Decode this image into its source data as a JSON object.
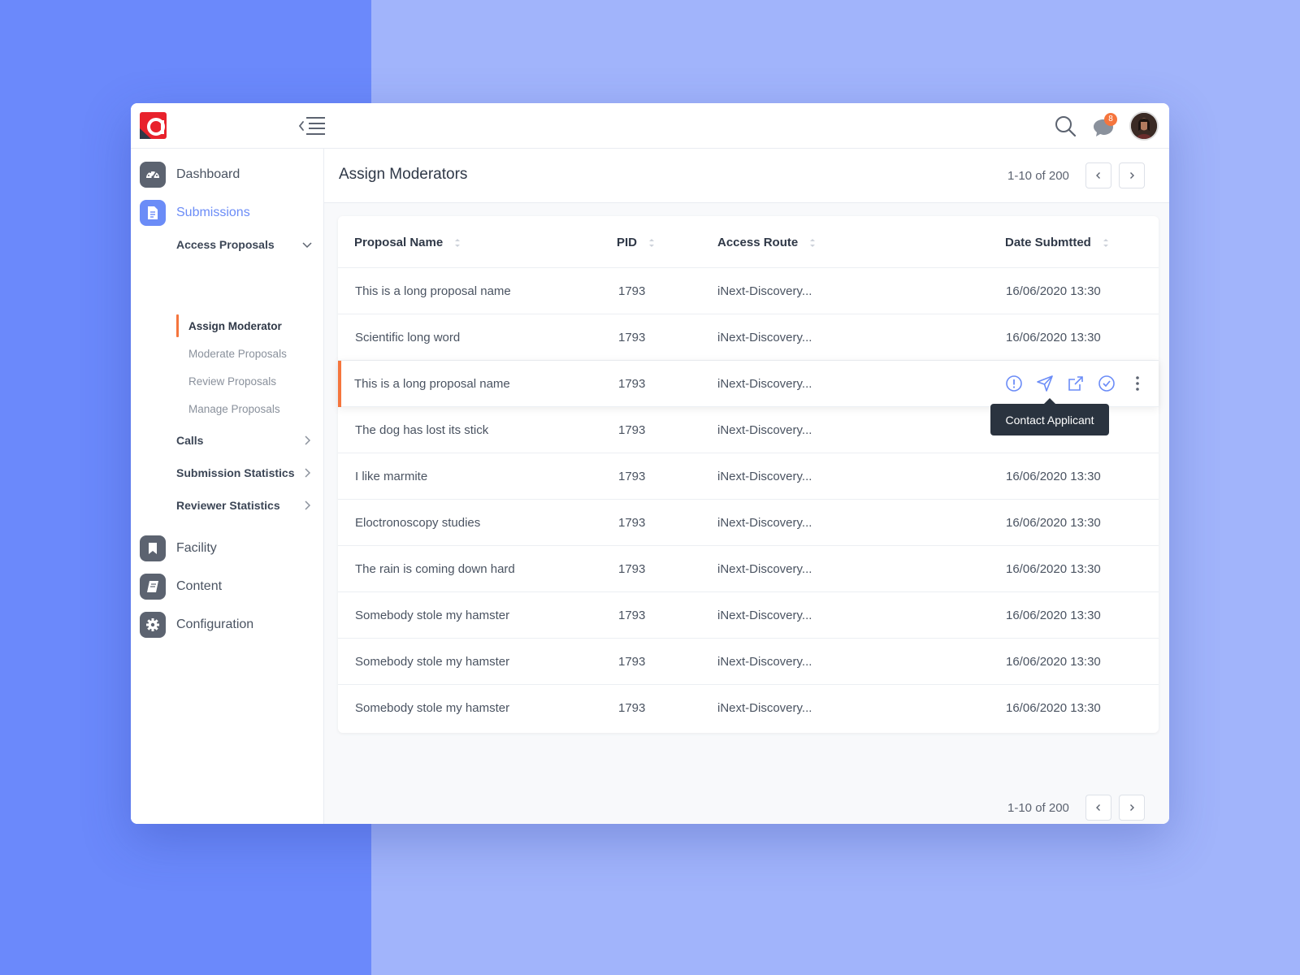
{
  "colors": {
    "accent": "#6b8cf7",
    "highlight": "#f5753d",
    "dark": "#2a333f"
  },
  "header": {
    "notification_count": "8"
  },
  "sidebar": {
    "dashboard": "Dashboard",
    "submissions": "Submissions",
    "access_proposals": "Access Proposals",
    "sub_items": [
      "Assign Moderator",
      "Moderate Proposals",
      "Review Proposals",
      "Manage Proposals"
    ],
    "calls": "Calls",
    "submission_statistics": "Submission Statistics",
    "reviewer_statistics": "Reviewer Statistics",
    "facility": "Facility",
    "content": "Content",
    "configuration": "Configuration"
  },
  "main": {
    "title": "Assign Moderators",
    "pagination": "1-10 of 200",
    "columns": [
      "Proposal Name",
      "PID",
      "Access Route",
      "Date Submtted"
    ],
    "tooltip": "Contact Applicant",
    "rows": [
      {
        "name": "This is a long proposal name",
        "pid": "1793",
        "route": "iNext-Discovery...",
        "date": "16/06/2020 13:30"
      },
      {
        "name": "Scientific long word",
        "pid": "1793",
        "route": "iNext-Discovery...",
        "date": "16/06/2020 13:30"
      },
      {
        "name": "This is a long proposal name",
        "pid": "1793",
        "route": "iNext-Discovery...",
        "date": ""
      },
      {
        "name": "The dog has lost its stick",
        "pid": "1793",
        "route": "iNext-Discovery...",
        "date": ""
      },
      {
        "name": "I like marmite",
        "pid": "1793",
        "route": "iNext-Discovery...",
        "date": "16/06/2020 13:30"
      },
      {
        "name": "Eloctronoscopy studies",
        "pid": "1793",
        "route": "iNext-Discovery...",
        "date": "16/06/2020 13:30"
      },
      {
        "name": "The rain is coming down hard",
        "pid": "1793",
        "route": "iNext-Discovery...",
        "date": "16/06/2020 13:30"
      },
      {
        "name": "Somebody stole my hamster",
        "pid": "1793",
        "route": "iNext-Discovery...",
        "date": "16/06/2020 13:30"
      },
      {
        "name": "Somebody stole my hamster",
        "pid": "1793",
        "route": "iNext-Discovery...",
        "date": "16/06/2020 13:30"
      },
      {
        "name": "Somebody stole my hamster",
        "pid": "1793",
        "route": "iNext-Discovery...",
        "date": "16/06/2020 13:30"
      }
    ]
  }
}
